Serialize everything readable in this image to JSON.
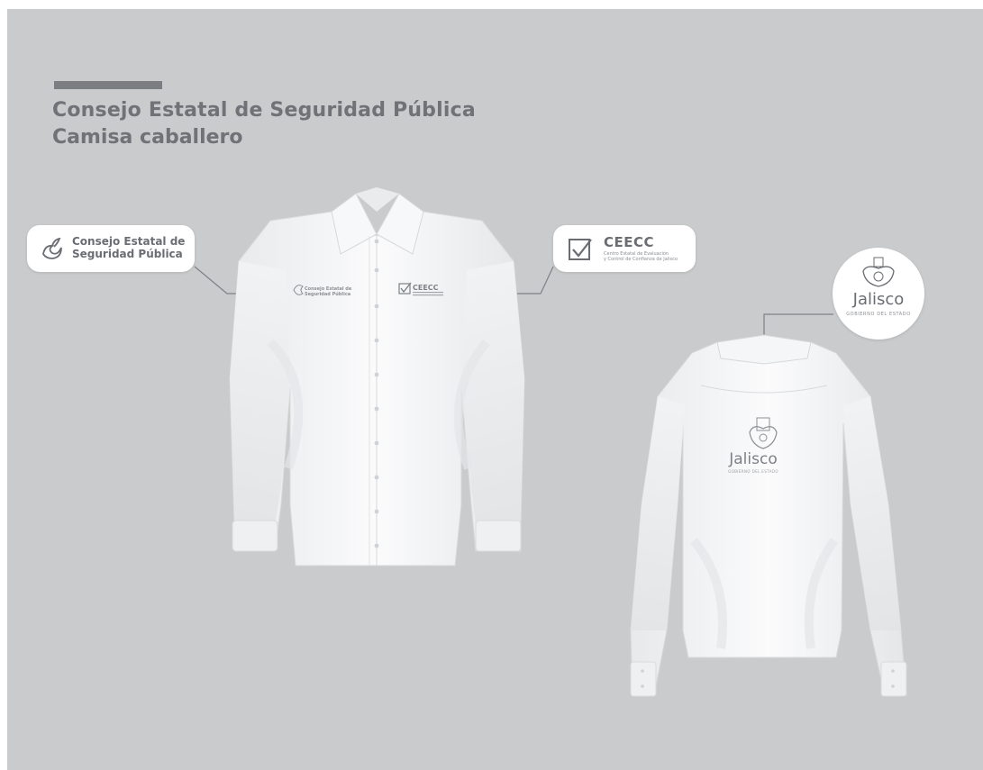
{
  "header": {
    "title": "Consejo Estatal de Seguridad Pública",
    "subtitle": "Camisa caballero"
  },
  "callouts": {
    "consejo": {
      "line1": "Consejo Estatal de",
      "line2": "Seguridad Pública",
      "icon": "dove-logo"
    },
    "ceecc": {
      "name": "CEECC",
      "sub_line1": "Centro Estatal de Evaluación",
      "sub_line2": "y Control de Confianza de Jalisco",
      "icon": "checkmark-box-logo"
    },
    "jalisco": {
      "name": "Jalisco",
      "sub": "GOBIERNO DEL ESTADO",
      "icon": "coat-of-arms-crest"
    }
  },
  "shirt_prints": {
    "front_left": {
      "line1": "Consejo Estatal de",
      "line2": "Seguridad Pública"
    },
    "front_right": {
      "name": "CEECC"
    },
    "back": {
      "name": "Jalisco",
      "sub": "GOBIERNO DEL ESTADO"
    }
  },
  "colors": {
    "background": "#c9cbcd",
    "brand_gray": "#6f7277",
    "shirt": "#f4f5f6",
    "callout": "#ffffff"
  }
}
